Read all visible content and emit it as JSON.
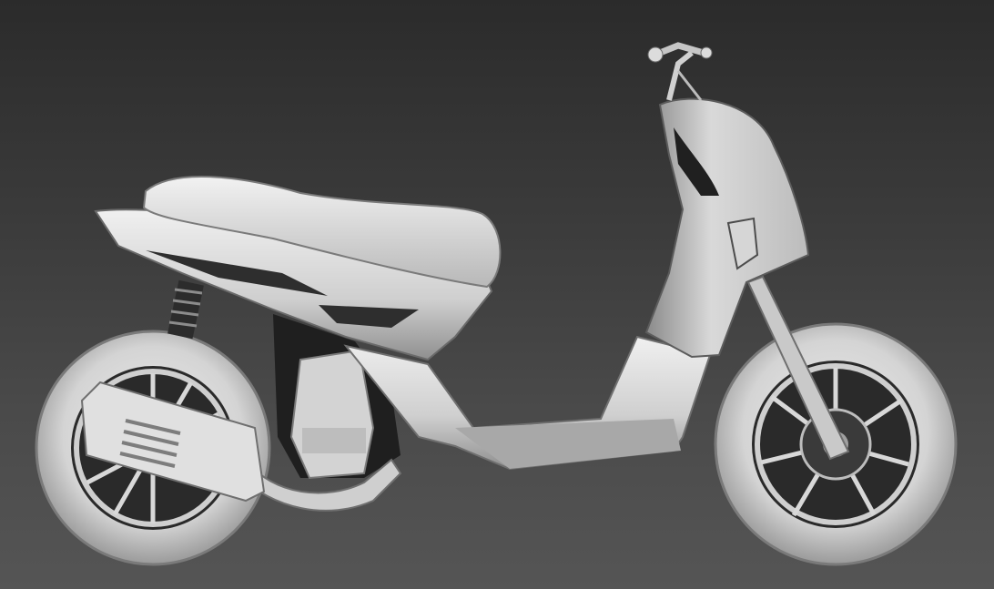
{
  "viewport": {
    "label": "",
    "background_top": "#2b2b2b",
    "background_bottom": "#555555"
  },
  "model": {
    "shade_light": "#e6e6e6",
    "shade_mid": "#bdbdbd",
    "shade_dark": "#5e5e5e",
    "shade_shadow": "#1a1a1a"
  }
}
